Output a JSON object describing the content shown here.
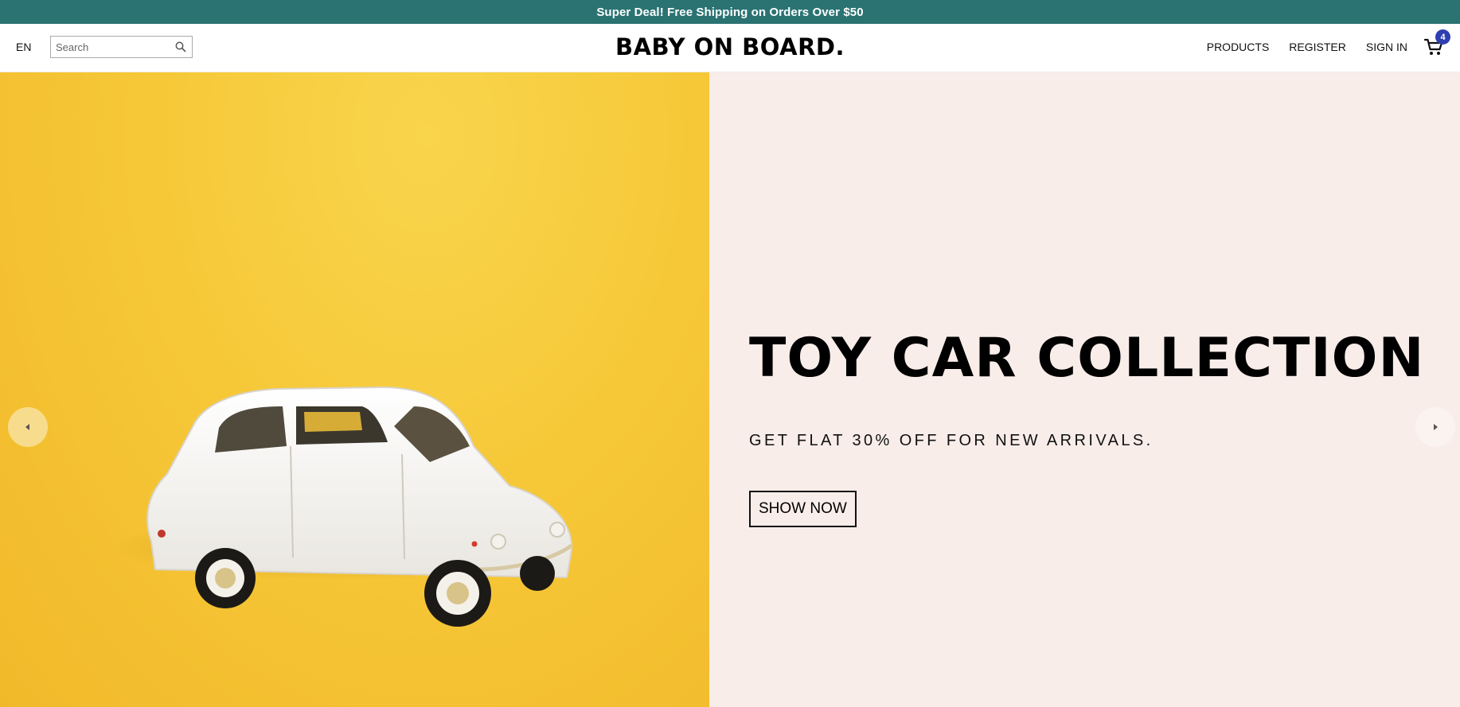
{
  "announcement": {
    "text": "Super Deal! Free Shipping on Orders Over $50"
  },
  "header": {
    "language": "EN",
    "search": {
      "placeholder": "Search",
      "value": ""
    },
    "logo": "BABY ON BOARD.",
    "nav": {
      "products": "PRODUCTS",
      "register": "REGISTER",
      "sign_in": "SIGN IN"
    },
    "cart": {
      "count": "4"
    }
  },
  "hero": {
    "title": "TOY CAR COLLECTION",
    "subtitle": "GET FLAT 30% OFF FOR NEW ARRIVALS.",
    "cta": "SHOW NOW"
  },
  "colors": {
    "announcement_bg": "#2b7373",
    "hero_left_bg": "#f6c838",
    "hero_right_bg": "#f8ede9",
    "cart_badge": "#2f3fb0"
  },
  "icons": {
    "search": "search-icon",
    "cart": "cart-icon",
    "prev": "chevron-left-icon",
    "next": "chevron-right-icon"
  }
}
